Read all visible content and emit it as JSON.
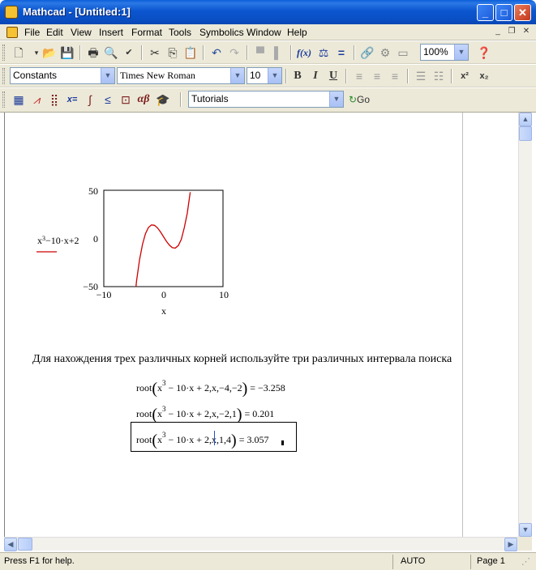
{
  "window": {
    "title": "Mathcad - [Untitled:1]"
  },
  "menubar": {
    "items": [
      "File",
      "Edit",
      "View",
      "Insert",
      "Format",
      "Tools",
      "Symbolics",
      "Window",
      "Help"
    ]
  },
  "toolbar_standard": {
    "zoom": "100%"
  },
  "toolbar_formatting": {
    "style": "Constants",
    "font": "Times New Roman",
    "size": "10"
  },
  "toolbar_math": {
    "resource": "Tutorials",
    "go_label": "Go"
  },
  "plot": {
    "function_label": "x",
    "function_exp": "3",
    "function_rest": "−10·x+2",
    "xlabel": "x",
    "y_ticks": [
      "50",
      "0",
      "−50"
    ],
    "x_ticks": [
      "−10",
      "0",
      "10"
    ],
    "trace_color": "#cc0000"
  },
  "chart_data": {
    "type": "line",
    "series": [
      {
        "expression": "x^3-10x+2",
        "x": [
          -5,
          -4.5,
          -4,
          -3.5,
          -3,
          -2.5,
          -2,
          -1.5,
          -1,
          -0.5,
          0,
          0.5,
          1,
          1.5,
          2,
          2.5,
          3,
          3.5,
          4,
          4.5
        ],
        "y": [
          -73,
          -44.1,
          -22,
          -5.9,
          5,
          11.4,
          14,
          13.6,
          11,
          6.9,
          2,
          -2.9,
          -7,
          -9.6,
          -10,
          -7.4,
          -1,
          10.9,
          26,
          48.1
        ]
      }
    ],
    "xlim": [
      -10,
      10
    ],
    "ylim": [
      -50,
      50
    ],
    "xlabel": "x",
    "grid": false
  },
  "document": {
    "instruction": "Для нахождения трех различных корней используйте три различных интервала поиска",
    "equations": [
      {
        "pre": "root",
        "base": "x",
        "exp": "3",
        "body": " − 10·x + 2,x,−4,−2",
        "result": " = −3.258"
      },
      {
        "pre": "root",
        "base": "x",
        "exp": "3",
        "body": " − 10·x + 2,x,−2,1",
        "result": " = 0.201"
      },
      {
        "pre": "root",
        "base": "x",
        "exp": "3",
        "body": " − 10·x + 2,x,1,4",
        "result": " = 3.057"
      }
    ]
  },
  "statusbar": {
    "help": "Press F1 for help.",
    "mode": "AUTO",
    "page": "Page 1"
  }
}
